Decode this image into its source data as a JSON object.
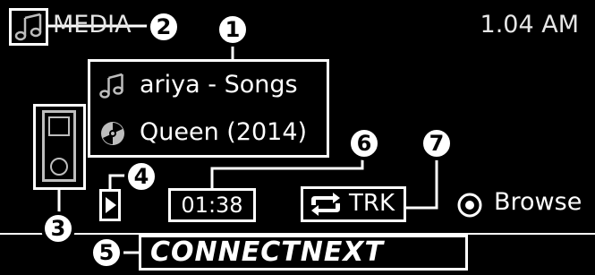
{
  "header": {
    "source_label": "MEDIA",
    "clock": "1.04 AM"
  },
  "now_playing": {
    "track": "ariya - Songs",
    "album": "Queen (2014)"
  },
  "playback": {
    "elapsed": "01:38",
    "repeat_mode": "TRK"
  },
  "actions": {
    "browse_label": "Browse"
  },
  "footer": {
    "brand": "CONNECTNEXT"
  },
  "callouts": {
    "c1": "1",
    "c2": "2",
    "c3": "3",
    "c4": "4",
    "c5": "5",
    "c6": "6",
    "c7": "7"
  },
  "icons": {
    "media_icon": "music-note-icon",
    "track_icon": "music-note-icon",
    "album_icon": "disc-icon",
    "device_icon": "media-player-icon",
    "play_icon": "play-icon",
    "repeat_icon": "repeat-icon",
    "browse_icon": "radio-dot-icon"
  },
  "colors": {
    "background": "#000000",
    "foreground": "#ffffff",
    "dim": "#bdbdbd"
  }
}
